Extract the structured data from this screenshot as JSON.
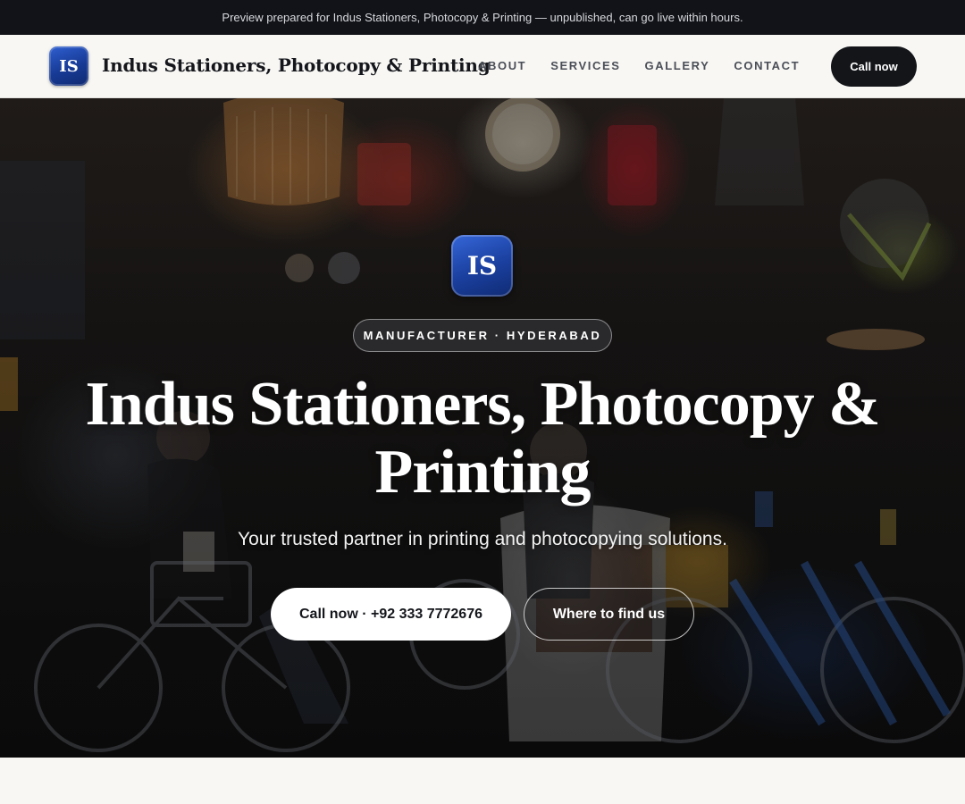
{
  "preview_banner": "Preview prepared for Indus Stationers, Photocopy & Printing — unpublished, can go live within hours.",
  "nav": {
    "logo_initials": "IS",
    "brand": "Indus Stationers, Photocopy & Printing",
    "links": [
      "ABOUT",
      "SERVICES",
      "GALLERY",
      "CONTACT"
    ],
    "cta": "Call now"
  },
  "hero": {
    "logo_initials": "IS",
    "badge": "MANUFACTURER · HYDERABAD",
    "title": "Indus Stationers, Photocopy & Printing",
    "subtitle": "Your trusted partner in printing and photocopying solutions.",
    "primary_button": "Call now · +92 333 7772676",
    "secondary_button": "Where to find us",
    "background_image": "shop-interior-photo"
  },
  "colors": {
    "accent_dark": "#131519",
    "logo_blue": "#1a3f9e",
    "page_bg": "#f8f7f4"
  }
}
